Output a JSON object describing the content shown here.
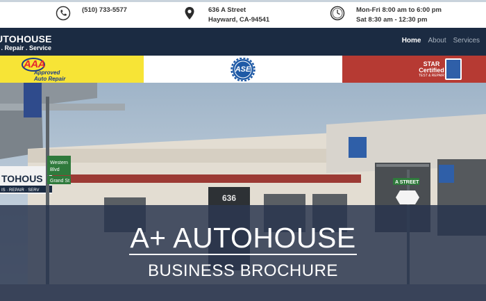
{
  "contact": {
    "phone": "(510) 733-5577",
    "address_line1": "636 A Street",
    "address_line2": "Hayward, CA-94541",
    "hours_line1": "Mon-Fri 8:00 am to 6:00 pm",
    "hours_line2": "Sat 8:30 am - 12:30 pm"
  },
  "brand": {
    "title": "UTOHOUSE",
    "tagline": "s . Repair . Service"
  },
  "nav": {
    "items": [
      {
        "label": "Home",
        "active": true
      },
      {
        "label": "About",
        "active": false
      },
      {
        "label": "Services",
        "active": false
      }
    ]
  },
  "logos": {
    "aaa_mark": "AAA",
    "aaa_line1": "Approved",
    "aaa_line2": "Auto Repair",
    "ase_mark": "ASE",
    "star_line1": "STAR",
    "star_line2": "Certified",
    "star_line3": "TEST & REPAIR"
  },
  "hero": {
    "title": "A+ AUTOHOUSE",
    "subtitle": "BUSINESS BROCHURE",
    "building_number": "636",
    "sign_street_1": "Western",
    "sign_street_2": "Blvd",
    "sign_street_3": "Grand St",
    "sign_a_street": "A STREET",
    "side_sign": "TOHOUS",
    "side_sign_sub": "IS · REPAIR · SERV"
  },
  "colors": {
    "navbar": "#1b2b42",
    "aaa_yellow": "#f7e436",
    "star_red": "#b63a33",
    "ase_blue": "#1f5aa6",
    "overlay": "#28344e"
  }
}
